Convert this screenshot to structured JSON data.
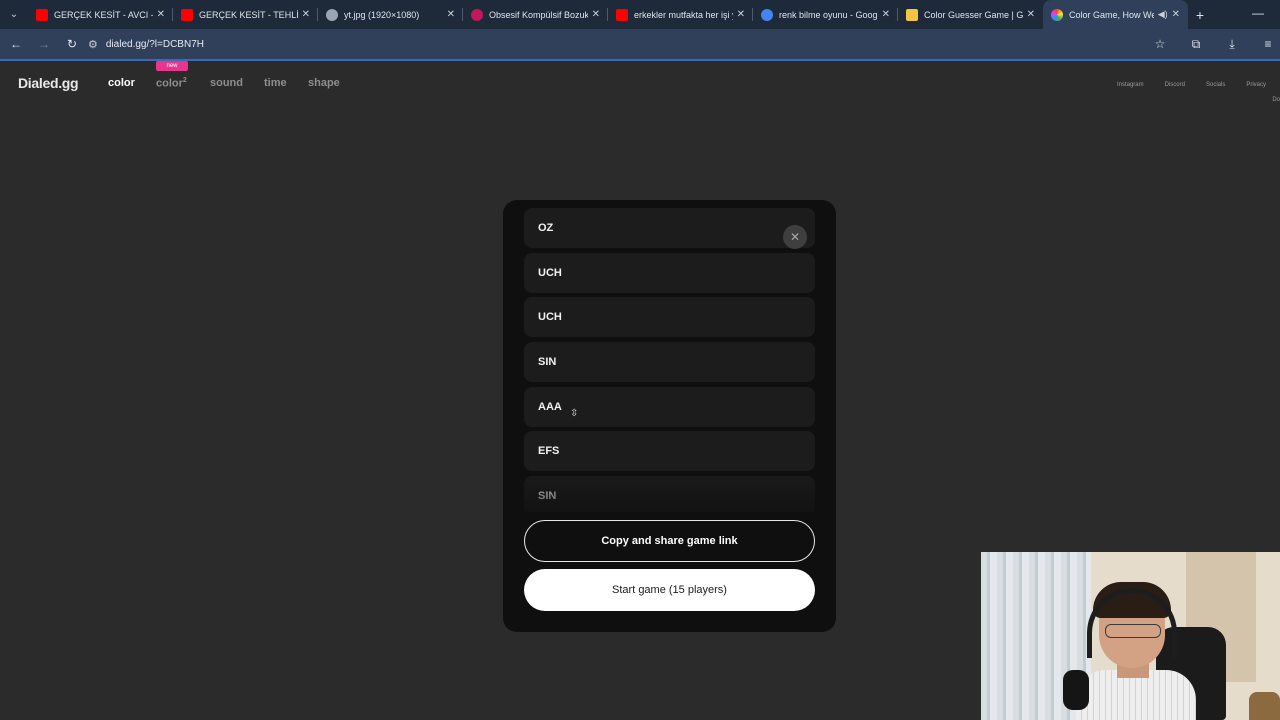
{
  "browser": {
    "tabs": [
      {
        "title": "GERÇEK KESİT - AVCI - Yo",
        "favicon_color": "#ff0000",
        "active": false
      },
      {
        "title": "GERÇEK KESİT - TEHLİKELİ",
        "favicon_color": "#ff0000",
        "active": false
      },
      {
        "title": "yt.jpg (1920×1080)",
        "favicon_color": "#9aa4b2",
        "active": false
      },
      {
        "title": "Obsesif Kompülsif Bozukl",
        "favicon_color": "#c2185b",
        "active": false
      },
      {
        "title": "erkekler mutfakta her işi y",
        "favicon_color": "#ff0000",
        "active": false
      },
      {
        "title": "renk bilme oyunu - Googl",
        "favicon_color": "#4285f4",
        "active": false
      },
      {
        "title": "Color Guesser Game | Gu",
        "favicon_color": "#f4c542",
        "active": false
      },
      {
        "title": "Color Game, How We",
        "favicon_color": "#e040fb",
        "active": true
      }
    ],
    "url": "dialed.gg/?l=DCBN7H"
  },
  "site": {
    "logo": "Dialed.gg",
    "nav": [
      {
        "label": "color",
        "active": true
      },
      {
        "label": "color",
        "sup": "2",
        "active": false
      },
      {
        "label": "sound",
        "active": false
      },
      {
        "label": "time",
        "active": false
      },
      {
        "label": "shape",
        "active": false
      }
    ],
    "new_badge": "new",
    "right_links": [
      "Instagram",
      "Discord",
      "Socials",
      "Privacy"
    ],
    "clipped_link": "Do"
  },
  "modal": {
    "players": [
      "OZ",
      "UCH",
      "UCH",
      "SIN",
      "AAA",
      "EFS",
      "SIN"
    ],
    "share_button": "Copy and share game link",
    "start_button": "Start game (15 players)"
  },
  "colors": {
    "page_bg": "#2b2b2b",
    "modal_bg": "#0f0f0f",
    "row_bg": "#1c1c1c",
    "badge": "#e8358f",
    "browser_frame": "#30405a"
  }
}
